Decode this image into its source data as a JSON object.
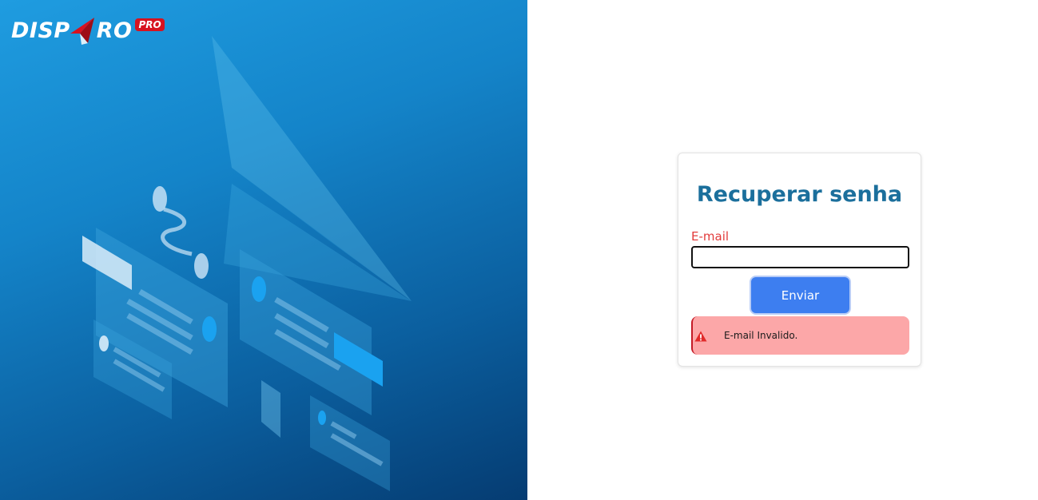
{
  "brand": {
    "name_part1": "DISP",
    "name_part2": "RO",
    "badge": "PRO",
    "plane_icon": "paper-plane-icon",
    "badge_color": "#d7121f"
  },
  "card": {
    "title": "Recuperar senha",
    "email": {
      "label": "E-mail",
      "value": "",
      "placeholder": ""
    },
    "submit_label": "Enviar",
    "alert": {
      "icon": "warning-triangle-icon",
      "message": "E-mail Invalido."
    }
  },
  "colors": {
    "title": "#1b6f9c",
    "label_error": "#e23b3b",
    "button": "#3d7ef0",
    "alert_bg": "#fca7a8",
    "alert_border": "#c41a26",
    "hero_gradient_start": "#1f9ce0",
    "hero_gradient_end": "#053c72"
  }
}
